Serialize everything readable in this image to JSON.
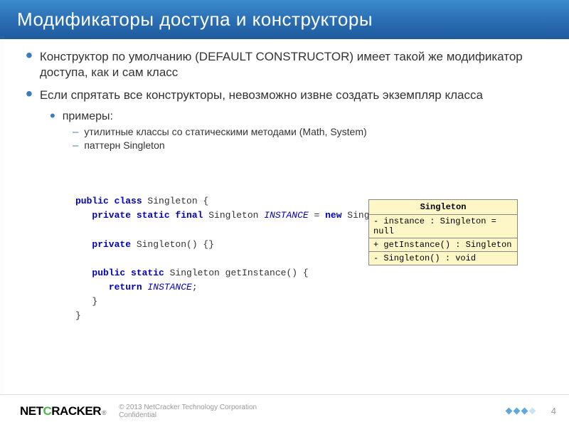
{
  "title": "Модификаторы доступа и конструкторы",
  "bullets": {
    "b1": "Конструктор по умолчанию (DEFAULT CONSTRUCTOR) имеет такой же модификатор доступа, как и сам класс",
    "b2": "Если спрятать все конструкторы, невозможно извне создать экземпляр класса",
    "b2_1": "примеры:",
    "b2_1_1": "утилитные классы со статическими методами (Math, System)",
    "b2_1_2": "паттерн Singleton"
  },
  "uml": {
    "title": "Singleton",
    "row1": "- instance : Singleton = null",
    "row2": "+ getInstance() : Singleton",
    "row3": "- Singleton() : void"
  },
  "code": {
    "l1a": "public class",
    "l1b": " Singleton {",
    "l2a": "private static final",
    "l2b": " Singleton ",
    "l2c": "INSTANCE",
    "l2d": " = ",
    "l2e": "new",
    "l2f": " Singleton();",
    "l3a": "private",
    "l3b": " Singleton() {}",
    "l4a": "public static",
    "l4b": " Singleton getInstance() {",
    "l5a": "return ",
    "l5b": "INSTANCE",
    "l5c": ";",
    "l6": "}",
    "l7": "}"
  },
  "footer": {
    "logo_net": "NET",
    "logo_c": "C",
    "logo_racker": "RACKER",
    "logo_reg": "®",
    "copyright_l1": "© 2013 NetCracker Technology Corporation",
    "copyright_l2": "Confidential"
  },
  "pagenum": "4"
}
